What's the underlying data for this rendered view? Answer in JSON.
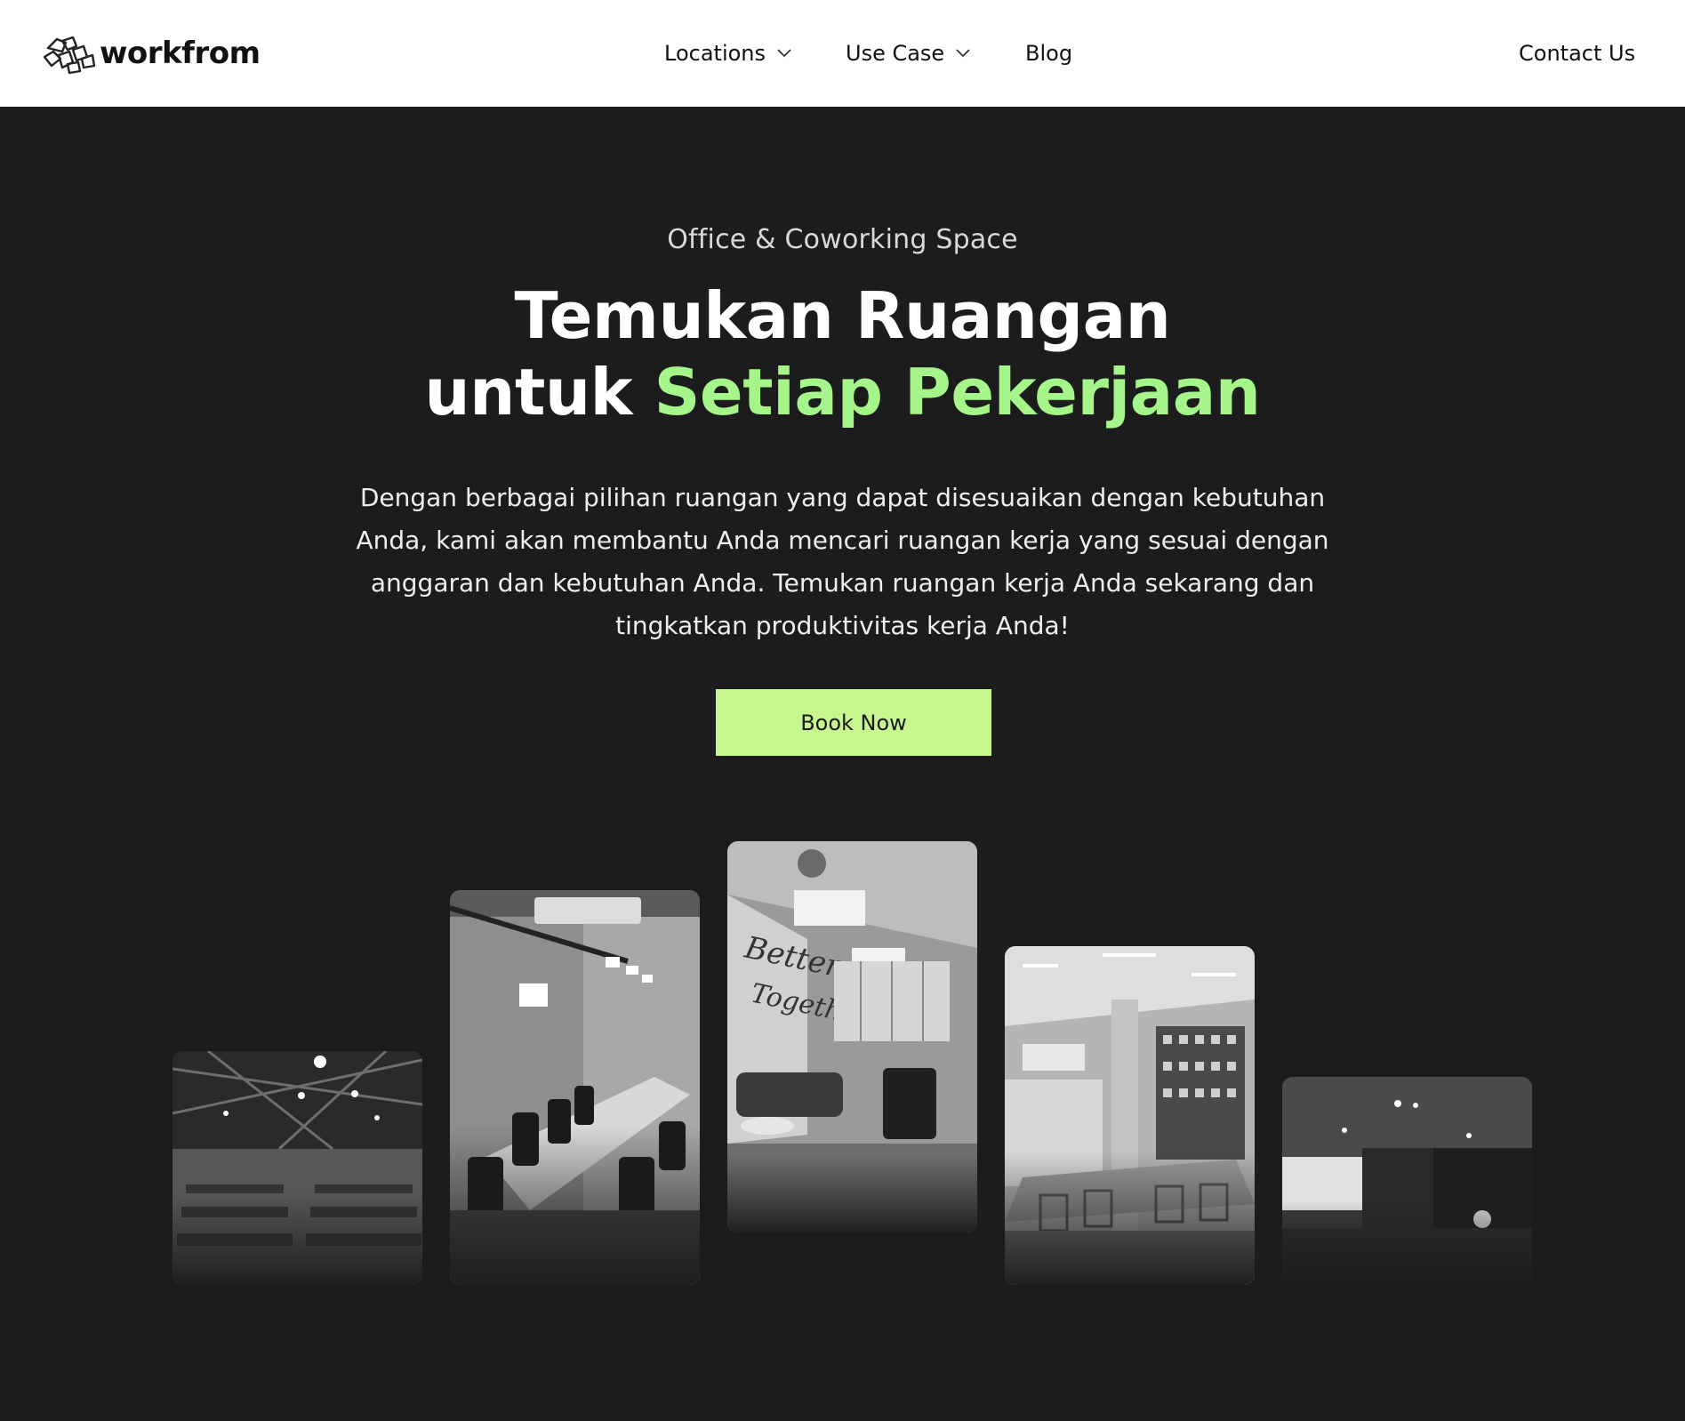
{
  "brand": {
    "name": "workfrom"
  },
  "nav": {
    "items": [
      {
        "label": "Locations",
        "has_dropdown": true
      },
      {
        "label": "Use Case",
        "has_dropdown": true
      },
      {
        "label": "Blog",
        "has_dropdown": false
      }
    ],
    "contact_label": "Contact Us"
  },
  "hero": {
    "subtitle": "Office & Coworking Space",
    "title_line1": "Temukan Ruangan",
    "title_line2_plain": "untuk",
    "title_line2_accent": "Setiap Pekerjaan",
    "description": "Dengan berbagai pilihan ruangan yang dapat disesuaikan dengan kebutuhan Anda, kami akan membantu Anda mencari ruangan kerja yang sesuai dengan anggaran dan kebutuhan Anda. Temukan ruangan kerja Anda sekarang dan tingkatkan produktivitas kerja Anda!",
    "cta_label": "Book Now"
  },
  "gallery": {
    "images": [
      {
        "subject": "hall-with-seating"
      },
      {
        "subject": "meeting-room"
      },
      {
        "subject": "lounge-better-together"
      },
      {
        "subject": "coworking-space"
      },
      {
        "subject": "event-projector-room"
      }
    ]
  },
  "colors": {
    "header_bg": "#ffffff",
    "page_bg": "#1c1c1c",
    "accent_green": "#a6f58a",
    "button_bg": "#c8f68e"
  }
}
